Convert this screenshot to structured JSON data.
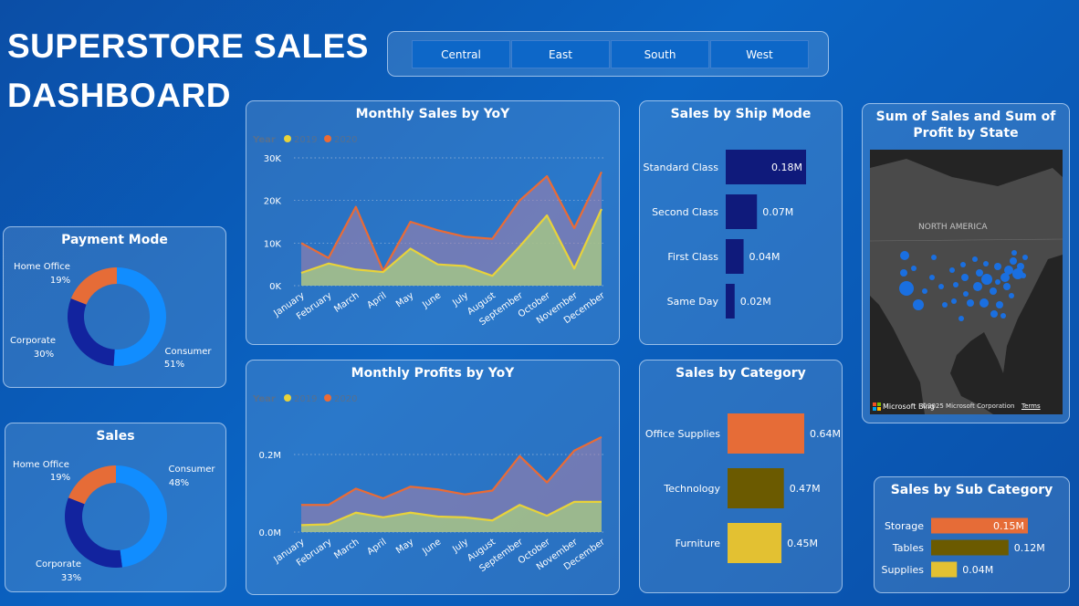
{
  "header": {
    "title_line1": "SUPERSTORE SALES",
    "title_line2": "DASHBOARD"
  },
  "region_slicer": {
    "options": [
      "Central",
      "East",
      "South",
      "West"
    ]
  },
  "colors": {
    "y2019": "#e8d23a",
    "y2020": "#ea6b35",
    "navy": "#0f1a7b",
    "consumer": "#118dff",
    "corporate": "#12239e",
    "home_office": "#e66c37",
    "office_supplies": "#e66c37",
    "technology": "#6b5a00",
    "furniture": "#e3c132"
  },
  "payment_mode": {
    "title": "Payment Mode",
    "slices": [
      {
        "name": "Consumer",
        "pct": "51%",
        "value": 51
      },
      {
        "name": "Corporate",
        "pct": "30%",
        "value": 30
      },
      {
        "name": "Home Office",
        "pct": "19%",
        "value": 19
      }
    ]
  },
  "sales_segment": {
    "title": "Sales",
    "slices": [
      {
        "name": "Consumer",
        "pct": "48%",
        "value": 48
      },
      {
        "name": "Corporate",
        "pct": "33%",
        "value": 33
      },
      {
        "name": "Home Office",
        "pct": "19%",
        "value": 19
      }
    ]
  },
  "ship_mode": {
    "title": "Sales by Ship Mode",
    "categories": [
      "Standard Class",
      "Second Class",
      "First Class",
      "Same Day"
    ],
    "values": [
      0.18,
      0.07,
      0.04,
      0.02
    ],
    "labels": [
      "0.18M",
      "0.07M",
      "0.04M",
      "0.02M"
    ]
  },
  "category": {
    "title": "Sales by Category",
    "categories": [
      "Office Supplies",
      "Technology",
      "Furniture"
    ],
    "values": [
      0.64,
      0.47,
      0.45
    ],
    "labels": [
      "0.64M",
      "0.47M",
      "0.45M"
    ]
  },
  "sub_category": {
    "title": "Sales by Sub Category",
    "categories": [
      "Storage",
      "Tables",
      "Supplies"
    ],
    "values": [
      0.15,
      0.12,
      0.04
    ],
    "labels": [
      "0.15M",
      "0.12M",
      "0.04M"
    ]
  },
  "map": {
    "title_line1": "Sum of Sales and Sum of",
    "title_line2": "Profit by State",
    "region_label": "NORTH AMERICA",
    "brand": "Microsoft Bing",
    "copyright": "©2025 Microsoft Corporation",
    "terms": "Terms"
  },
  "chart_data": [
    {
      "type": "area",
      "title": "Monthly Sales by YoY",
      "legend_title": "Year",
      "legend_position": "top-left",
      "categories": [
        "January",
        "February",
        "March",
        "April",
        "May",
        "June",
        "July",
        "August",
        "September",
        "October",
        "November",
        "December"
      ],
      "ytick_labels": [
        "0K",
        "10K",
        "20K",
        "30K"
      ],
      "ylim": [
        0,
        30000
      ],
      "grid": true,
      "series": [
        {
          "name": "2019",
          "values": [
            3000,
            5200,
            3800,
            3200,
            8700,
            5000,
            4600,
            2300,
            9200,
            16500,
            4000,
            18000
          ]
        },
        {
          "name": "2020",
          "values": [
            10000,
            6500,
            18500,
            3500,
            15000,
            13000,
            11500,
            11000,
            20000,
            25700,
            13500,
            26700
          ]
        }
      ]
    },
    {
      "type": "area",
      "title": "Monthly Profits by YoY",
      "legend_title": "Year",
      "legend_position": "top-left",
      "categories": [
        "January",
        "February",
        "March",
        "April",
        "May",
        "June",
        "July",
        "August",
        "September",
        "October",
        "November",
        "December"
      ],
      "ytick_labels": [
        "0.0M",
        "0.2M"
      ],
      "ylim": [
        0,
        0.4
      ],
      "grid": true,
      "series": [
        {
          "name": "2019",
          "values": [
            0.018,
            0.02,
            0.05,
            0.038,
            0.05,
            0.04,
            0.038,
            0.03,
            0.07,
            0.042,
            0.078,
            0.078
          ]
        },
        {
          "name": "2020",
          "values": [
            0.07,
            0.07,
            0.112,
            0.087,
            0.117,
            0.11,
            0.097,
            0.107,
            0.196,
            0.128,
            0.21,
            0.245
          ]
        }
      ]
    }
  ]
}
